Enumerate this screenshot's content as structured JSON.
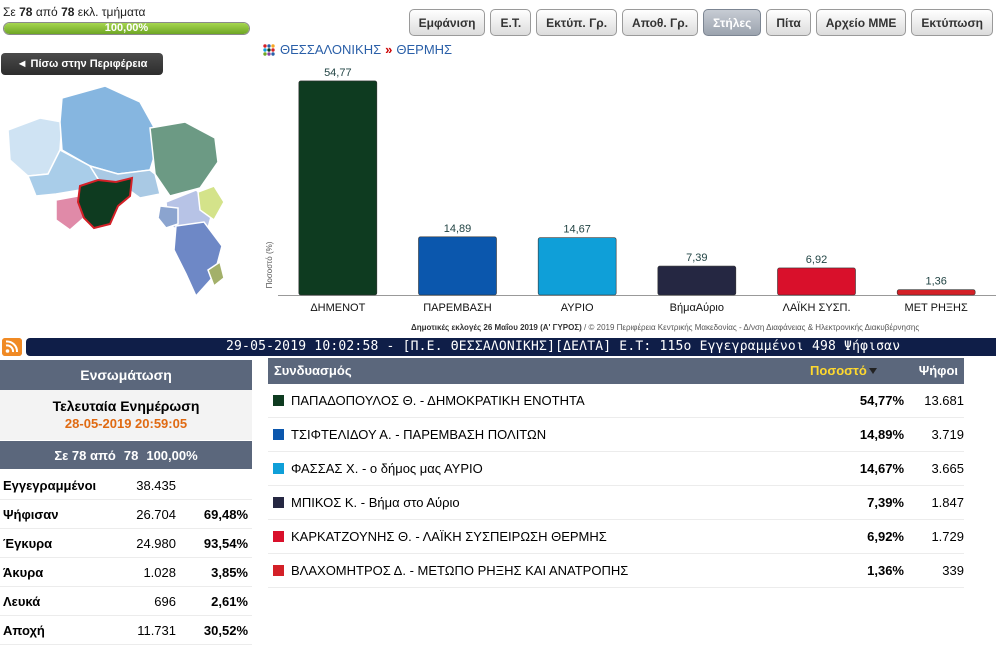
{
  "progress": {
    "prefix": "Σε",
    "counted": "78",
    "middle": "από",
    "total": "78",
    "suffix": "εκλ. τμήματα",
    "percent_text": "100,00%",
    "fraction": 1.0
  },
  "toolbar": [
    {
      "label": "Εμφάνιση",
      "active": false
    },
    {
      "label": "Ε.Τ.",
      "active": false
    },
    {
      "label": "Εκτύπ. Γρ.",
      "active": false
    },
    {
      "label": "Αποθ. Γρ.",
      "active": false
    },
    {
      "label": "Στήλες",
      "active": true
    },
    {
      "label": "Πίτα",
      "active": false
    },
    {
      "label": "Αρχείο ΜΜΕ",
      "active": false
    },
    {
      "label": "Εκτύπωση",
      "active": false
    }
  ],
  "back_button": "◄ Πίσω στην Περιφέρεια",
  "breadcrumb": {
    "region": "ΘΕΣΣΑΛΟΝΙΚΗΣ",
    "separator": "»",
    "municipality": "ΘΕΡΜΗΣ"
  },
  "chart_data": {
    "type": "bar",
    "categories": [
      "ΔΗΜΕΝΟΤ",
      "ΠΑΡΕΜΒΑΣΗ",
      "ΑΥΡΙΟ",
      "ΒήμαΑύριο",
      "ΛΑΪΚΗ ΣΥΣΠ.",
      "ΜΕΤ ΡΗΞΗΣ"
    ],
    "values": [
      54.77,
      14.89,
      14.67,
      7.39,
      6.92,
      1.36
    ],
    "value_labels": [
      "54,77",
      "14,89",
      "14,67",
      "7,39",
      "6,92",
      "1,36"
    ],
    "colors": [
      "#0e3b20",
      "#0b57ad",
      "#0f9fd8",
      "#252742",
      "#d9102b",
      "#d32027"
    ],
    "ylabel": "Ποσοστό (%)",
    "ylim": [
      0,
      55
    ],
    "grid": false,
    "footer_bold": "Δημοτικές εκλογές 26 Μαΐου 2019 (Α' ΓΥΡΟΣ)",
    "footer_rest": " / © 2019 Περιφέρεια Κεντρικής Μακεδονίας - Δ/νση Διαφάνειας & Ηλεκτρονικής Διακυβέρνησης"
  },
  "ticker": "29-05-2019 10:02:58 - [Π.Ε. ΘΕΣΣΑΛΟΝΙΚΗΣ][ΔΕΛΤΑ]  Ε.Τ: 115ο  Εγγεγραμμένοι 498  Ψήφισαν",
  "left_panel": {
    "title": "Ενσωμάτωση",
    "update_label": "Τελευταία Ενημέρωση",
    "update_time": "28-05-2019 20:59:05",
    "count_prefix": "Σε 78 από",
    "count_total": "78",
    "count_percent": "100,00%",
    "stats": [
      {
        "label": "Εγγεγραμμένοι",
        "value": "38.435",
        "percent": ""
      },
      {
        "label": "Ψήφισαν",
        "value": "26.704",
        "percent": "69,48%"
      },
      {
        "label": "Έγκυρα",
        "value": "24.980",
        "percent": "93,54%"
      },
      {
        "label": "Άκυρα",
        "value": "1.028",
        "percent": "3,85%"
      },
      {
        "label": "Λευκά",
        "value": "696",
        "percent": "2,61%"
      },
      {
        "label": "Αποχή",
        "value": "11.731",
        "percent": "30,52%"
      }
    ]
  },
  "results": {
    "col_combination": "Συνδυασμός",
    "col_percent": "Ποσοστό",
    "col_votes": "Ψήφοι",
    "rows": [
      {
        "name": "ΠΑΠΑΔΟΠΟΥΛΟΣ Θ. - ΔΗΜΟΚΡΑΤΙΚΗ ΕΝΟΤΗΤΑ",
        "percent": "54,77%",
        "votes": "13.681",
        "color": "#0e3b20"
      },
      {
        "name": "ΤΣΙΦΤΕΛΙΔΟΥ Α. - ΠΑΡΕΜΒΑΣΗ ΠΟΛΙΤΩΝ",
        "percent": "14,89%",
        "votes": "3.719",
        "color": "#0b57ad"
      },
      {
        "name": "ΦΑΣΣΑΣ Χ. - ο δήμος μας ΑΥΡΙΟ",
        "percent": "14,67%",
        "votes": "3.665",
        "color": "#0f9fd8"
      },
      {
        "name": "ΜΠΙΚΟΣ Κ. - Βήμα στο Αύριο",
        "percent": "7,39%",
        "votes": "1.847",
        "color": "#252742"
      },
      {
        "name": "ΚΑΡΚΑΤΖΟΥΝΗΣ Θ. - ΛΑΪΚΗ ΣΥΣΠΕΙΡΩΣΗ ΘΕΡΜΗΣ",
        "percent": "6,92%",
        "votes": "1.729",
        "color": "#d9102b"
      },
      {
        "name": "ΒΛΑΧΟΜΗΤΡΟΣ Δ. - ΜΕΤΩΠΟ ΡΗΞΗΣ ΚΑΙ ΑΝΑΤΡΟΠΗΣ",
        "percent": "1,36%",
        "votes": "339",
        "color": "#d32027"
      }
    ]
  }
}
